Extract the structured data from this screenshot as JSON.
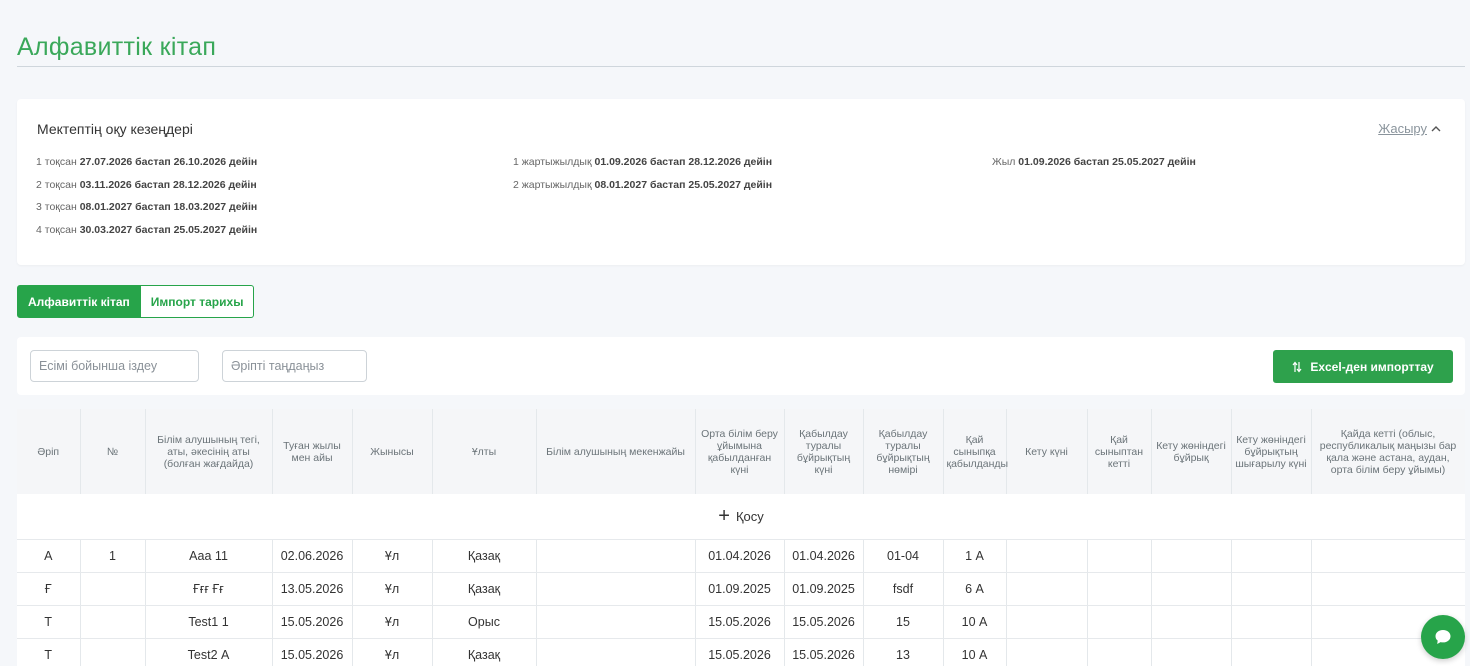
{
  "page": {
    "title": "Алфавиттік кітап"
  },
  "periods": {
    "title": "Мектептің оқу кезеңдері",
    "hide_label": "Жасыру",
    "quarters": [
      {
        "label": "1 тоқсан",
        "value": "27.07.2026 бастап 26.10.2026 дейін"
      },
      {
        "label": "2 тоқсан",
        "value": "03.11.2026 бастап 28.12.2026 дейін"
      },
      {
        "label": "3 тоқсан",
        "value": "08.01.2027 бастап 18.03.2027 дейін"
      },
      {
        "label": "4 тоқсан",
        "value": "30.03.2027 бастап 25.05.2027 дейін"
      }
    ],
    "halves": [
      {
        "label": "1 жартыжылдық",
        "value": "01.09.2026 бастап 28.12.2026 дейін"
      },
      {
        "label": "2 жартыжылдық",
        "value": "08.01.2027 бастап 25.05.2027 дейін"
      }
    ],
    "year": {
      "label": "Жыл",
      "value": "01.09.2026 бастап 25.05.2027 дейін"
    }
  },
  "tabs": [
    {
      "label": "Алфавиттік кітап",
      "active": true
    },
    {
      "label": "Импорт тарихы",
      "active": false
    }
  ],
  "filters": {
    "name_placeholder": "Есімі бойынша іздеу",
    "letter_placeholder": "Әріпті таңдаңыз",
    "import_button": "Excel-ден импорттау"
  },
  "table": {
    "columns": [
      "Әріп",
      "№",
      "Білім алушының тегі, аты, әкесінің аты (болған жағдайда)",
      "Туған жылы мен айы",
      "Жынысы",
      "Ұлты",
      "Білім алушының мекенжайы",
      "Орта білім беру ұйымына қабылданған күні",
      "Қабылдау туралы бұйрықтың күні",
      "Қабылдау туралы бұйрықтың нөмірі",
      "Қай сыныпқа қабылданды",
      "Кету күні",
      "Қай сыныптан кетті",
      "Кету жөніндегі бұйрық",
      "Кету жөніндегі бұйрықтың шығарылу күні",
      "Қайда кетті (облыс, республикалық маңызы бар қала және астана, аудан, орта білім беру ұйымы)"
    ],
    "add_label": "Қосу",
    "rows": [
      [
        "А",
        "1",
        "Ааа 11",
        "02.06.2026",
        "Ұл",
        "Қазақ",
        "",
        "01.04.2026",
        "01.04.2026",
        "01-04",
        "1 А",
        "",
        "",
        "",
        "",
        ""
      ],
      [
        "Ғ",
        "",
        "Ғғғ Ғғ",
        "13.05.2026",
        "Ұл",
        "Қазақ",
        "",
        "01.09.2025",
        "01.09.2025",
        "fsdf",
        "6 А",
        "",
        "",
        "",
        "",
        ""
      ],
      [
        "Т",
        "",
        "Test1 1",
        "15.05.2026",
        "Ұл",
        "Орыс",
        "",
        "15.05.2026",
        "15.05.2026",
        "15",
        "10 А",
        "",
        "",
        "",
        "",
        ""
      ],
      [
        "Т",
        "",
        "Test2 А",
        "15.05.2026",
        "Ұл",
        "Қазақ",
        "",
        "15.05.2026",
        "15.05.2026",
        "13",
        "10 А",
        "",
        "",
        "",
        "",
        ""
      ]
    ]
  },
  "icons": {
    "hide_chevron": "chevron-up-icon",
    "import": "sort-arrows-icon",
    "add": "plus-icon",
    "chat": "chat-bubble-icon"
  },
  "colors": {
    "accent": "#27a44a",
    "title_green": "#3aa85a"
  }
}
